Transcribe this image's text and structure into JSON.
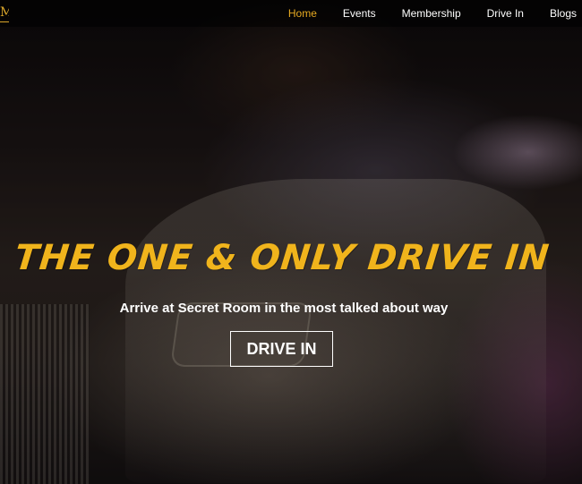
{
  "nav": {
    "logo_text": "M",
    "items": [
      {
        "label": "Home",
        "active": true
      },
      {
        "label": "Events",
        "active": false
      },
      {
        "label": "Membership",
        "active": false
      },
      {
        "label": "Drive In",
        "active": false
      },
      {
        "label": "Blogs",
        "active": false
      }
    ]
  },
  "hero": {
    "headline": "THE ONE & ONLY DRIVE IN",
    "subline": "Arrive at Secret Room in the most talked about way",
    "cta_label": "DRIVE IN"
  },
  "colors": {
    "accent": "#e6a921",
    "headline": "#f0b41c",
    "text": "#ffffff",
    "background": "#0a0708"
  }
}
